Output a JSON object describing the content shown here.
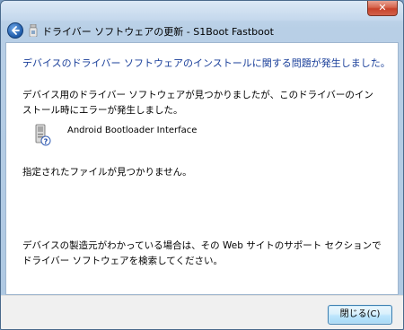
{
  "window": {
    "close_glyph": "✕"
  },
  "header": {
    "title": "ドライバー ソフトウェアの更新 - S1Boot Fastboot",
    "back_icon": "back-arrow-icon",
    "driver_icon": "usb-device-icon"
  },
  "content": {
    "heading": "デバイスのドライバー ソフトウェアのインストールに関する問題が発生しました。",
    "message": "デバイス用のドライバー ソフトウェアが見つかりましたが、このドライバーのインストール時にエラーが発生しました。",
    "device_icon": "unknown-device-icon",
    "device_name": "Android Bootloader Interface",
    "error": "指定されたファイルが見つかりません。",
    "footer": "デバイスの製造元がわかっている場合は、その Web サイトのサポート セクションでドライバー ソフトウェアを検索してください。"
  },
  "buttons": {
    "close_label": "閉じる(C)"
  },
  "colors": {
    "heading": "#1a3f9a",
    "close_button_border": "#3c7fb1",
    "titlebar_close": "#c7412a"
  }
}
